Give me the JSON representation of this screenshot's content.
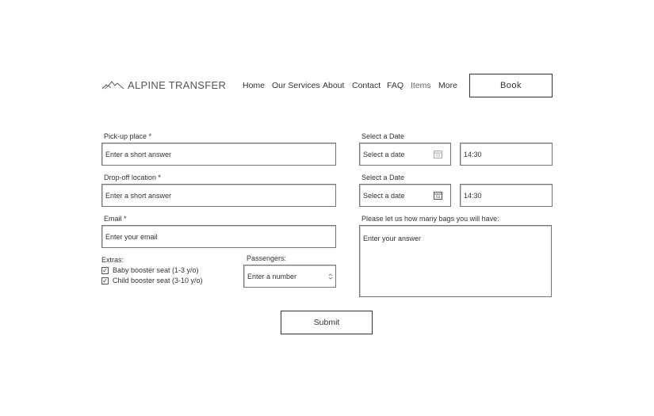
{
  "header": {
    "brand": "ALPINE TRANSFER",
    "nav": [
      "Home",
      "Our Services",
      "About",
      "Contact",
      "FAQ",
      "Items",
      "More"
    ],
    "book_label": "Book"
  },
  "form": {
    "pickup": {
      "label": "Pick-up place *",
      "placeholder": "Enter a short answer"
    },
    "dropoff": {
      "label": "Drop-off location *",
      "placeholder": "Enter a short answer"
    },
    "email": {
      "label": "Email *",
      "placeholder": "Enter your email"
    },
    "extras": {
      "label": "Extras:",
      "options": [
        {
          "label": "Baby booster seat (1-3 y/o)",
          "checked": true
        },
        {
          "label": "Child booster seat (3-10 y/o)",
          "checked": true
        }
      ]
    },
    "passengers": {
      "label": "Passengers:",
      "placeholder": "Enter a number"
    },
    "date1": {
      "label": "Select a Date",
      "placeholder": "Select a date",
      "time": "14:30"
    },
    "date2": {
      "label": "Select a Date",
      "placeholder": "Select a date",
      "time": "14:30"
    },
    "bags": {
      "label": "Please let us how many bags you will have:",
      "placeholder": "Enter your answer"
    },
    "submit_label": "Submit"
  }
}
